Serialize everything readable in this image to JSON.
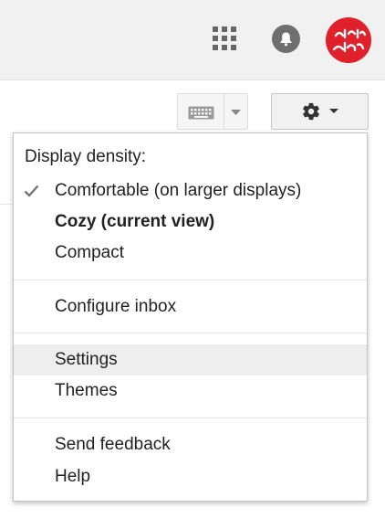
{
  "header": {
    "apps_icon": "apps-grid-icon",
    "notifications_icon": "bell-icon",
    "avatar_text_line1": "علم",
    "avatar_text_line2": "فردا",
    "avatar_color": "#e0202a"
  },
  "toolbar": {
    "keyboard_icon": "keyboard-icon",
    "settings_icon": "gear-icon"
  },
  "menu": {
    "heading": "Display density:",
    "density_options": [
      {
        "label": "Comfortable (on larger displays)",
        "checked": true,
        "bold": false
      },
      {
        "label": "Cozy (current view)",
        "checked": false,
        "bold": true
      },
      {
        "label": "Compact",
        "checked": false,
        "bold": false
      }
    ],
    "configure_inbox": "Configure inbox",
    "settings": "Settings",
    "themes": "Themes",
    "send_feedback": "Send feedback",
    "help": "Help"
  }
}
